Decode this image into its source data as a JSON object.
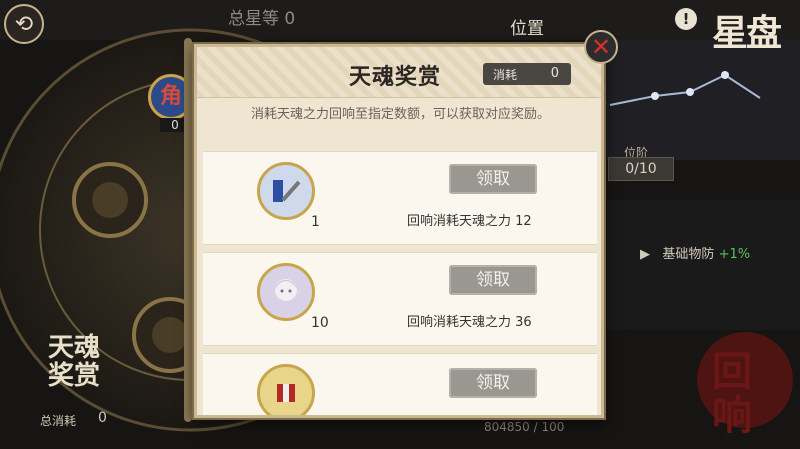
{
  "background": {
    "back_icon": "back-arrow-icon",
    "total_stars_label": "总星等 0",
    "position_label": "位置",
    "page_title": "星盘",
    "stage_label": "位阶",
    "stage_value": "0/10",
    "stat_name": "基础物防",
    "stat_bonus": "+1%",
    "mansion_char": "角",
    "mansion_count": "0",
    "tianhun_logo": "天魂奖赏",
    "total_consume_label": "总消耗",
    "total_consume_value": "0",
    "huixiang_stamp": "回响",
    "progress": "804850 / 100"
  },
  "popup": {
    "title": "天魂奖赏",
    "consume_label": "消耗",
    "consume_value": "0",
    "description": "消耗天魂之力回响至指定数额，可以获取对应奖励。",
    "rewards": [
      {
        "count": "1",
        "claim_label": "领取",
        "condition": "回响消耗天魂之力 12",
        "icon": "equipment-icon"
      },
      {
        "count": "10",
        "claim_label": "领取",
        "condition": "回响消耗天魂之力 36",
        "icon": "character-portrait-icon"
      },
      {
        "count": "",
        "claim_label": "领取",
        "condition": "",
        "icon": "item-icon"
      }
    ],
    "close_icon": "close-icon"
  },
  "colors": {
    "parchment": "#efe6d2",
    "button_gray": "#9a9690",
    "frame_gold": "#c8a44c",
    "close_red": "#d2302a"
  }
}
